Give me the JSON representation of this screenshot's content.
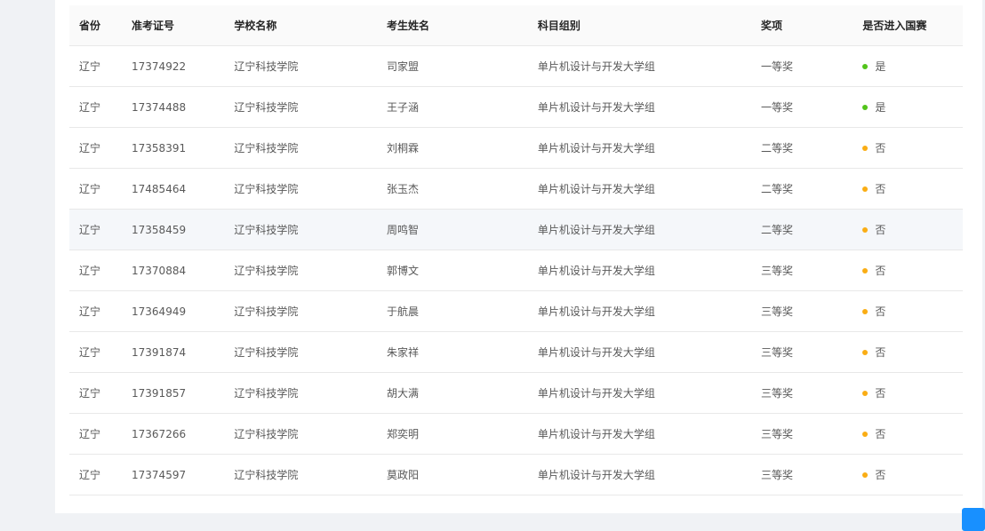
{
  "table": {
    "headers": [
      "省份",
      "准考证号",
      "学校名称",
      "考生姓名",
      "科目组别",
      "奖项",
      "是否进入国赛"
    ],
    "rows": [
      {
        "province": "辽宁",
        "id": "17374922",
        "school": "辽宁科技学院",
        "name": "司家盟",
        "group": "单片机设计与开发大学组",
        "award": "一等奖",
        "status": "是",
        "status_color": "#52c41a"
      },
      {
        "province": "辽宁",
        "id": "17374488",
        "school": "辽宁科技学院",
        "name": "王子涵",
        "group": "单片机设计与开发大学组",
        "award": "一等奖",
        "status": "是",
        "status_color": "#52c41a"
      },
      {
        "province": "辽宁",
        "id": "17358391",
        "school": "辽宁科技学院",
        "name": "刘桐霖",
        "group": "单片机设计与开发大学组",
        "award": "二等奖",
        "status": "否",
        "status_color": "#faad14"
      },
      {
        "province": "辽宁",
        "id": "17485464",
        "school": "辽宁科技学院",
        "name": "张玉杰",
        "group": "单片机设计与开发大学组",
        "award": "二等奖",
        "status": "否",
        "status_color": "#faad14"
      },
      {
        "province": "辽宁",
        "id": "17358459",
        "school": "辽宁科技学院",
        "name": "周鸣智",
        "group": "单片机设计与开发大学组",
        "award": "二等奖",
        "status": "否",
        "status_color": "#faad14"
      },
      {
        "province": "辽宁",
        "id": "17370884",
        "school": "辽宁科技学院",
        "name": "郭博文",
        "group": "单片机设计与开发大学组",
        "award": "三等奖",
        "status": "否",
        "status_color": "#faad14"
      },
      {
        "province": "辽宁",
        "id": "17364949",
        "school": "辽宁科技学院",
        "name": "于航晨",
        "group": "单片机设计与开发大学组",
        "award": "三等奖",
        "status": "否",
        "status_color": "#faad14"
      },
      {
        "province": "辽宁",
        "id": "17391874",
        "school": "辽宁科技学院",
        "name": "朱家祥",
        "group": "单片机设计与开发大学组",
        "award": "三等奖",
        "status": "否",
        "status_color": "#faad14"
      },
      {
        "province": "辽宁",
        "id": "17391857",
        "school": "辽宁科技学院",
        "name": "胡大满",
        "group": "单片机设计与开发大学组",
        "award": "三等奖",
        "status": "否",
        "status_color": "#faad14"
      },
      {
        "province": "辽宁",
        "id": "17367266",
        "school": "辽宁科技学院",
        "name": "郑奕明",
        "group": "单片机设计与开发大学组",
        "award": "三等奖",
        "status": "否",
        "status_color": "#faad14"
      },
      {
        "province": "辽宁",
        "id": "17374597",
        "school": "辽宁科技学院",
        "name": "莫政阳",
        "group": "单片机设计与开发大学组",
        "award": "三等奖",
        "status": "否",
        "status_color": "#faad14"
      }
    ]
  }
}
